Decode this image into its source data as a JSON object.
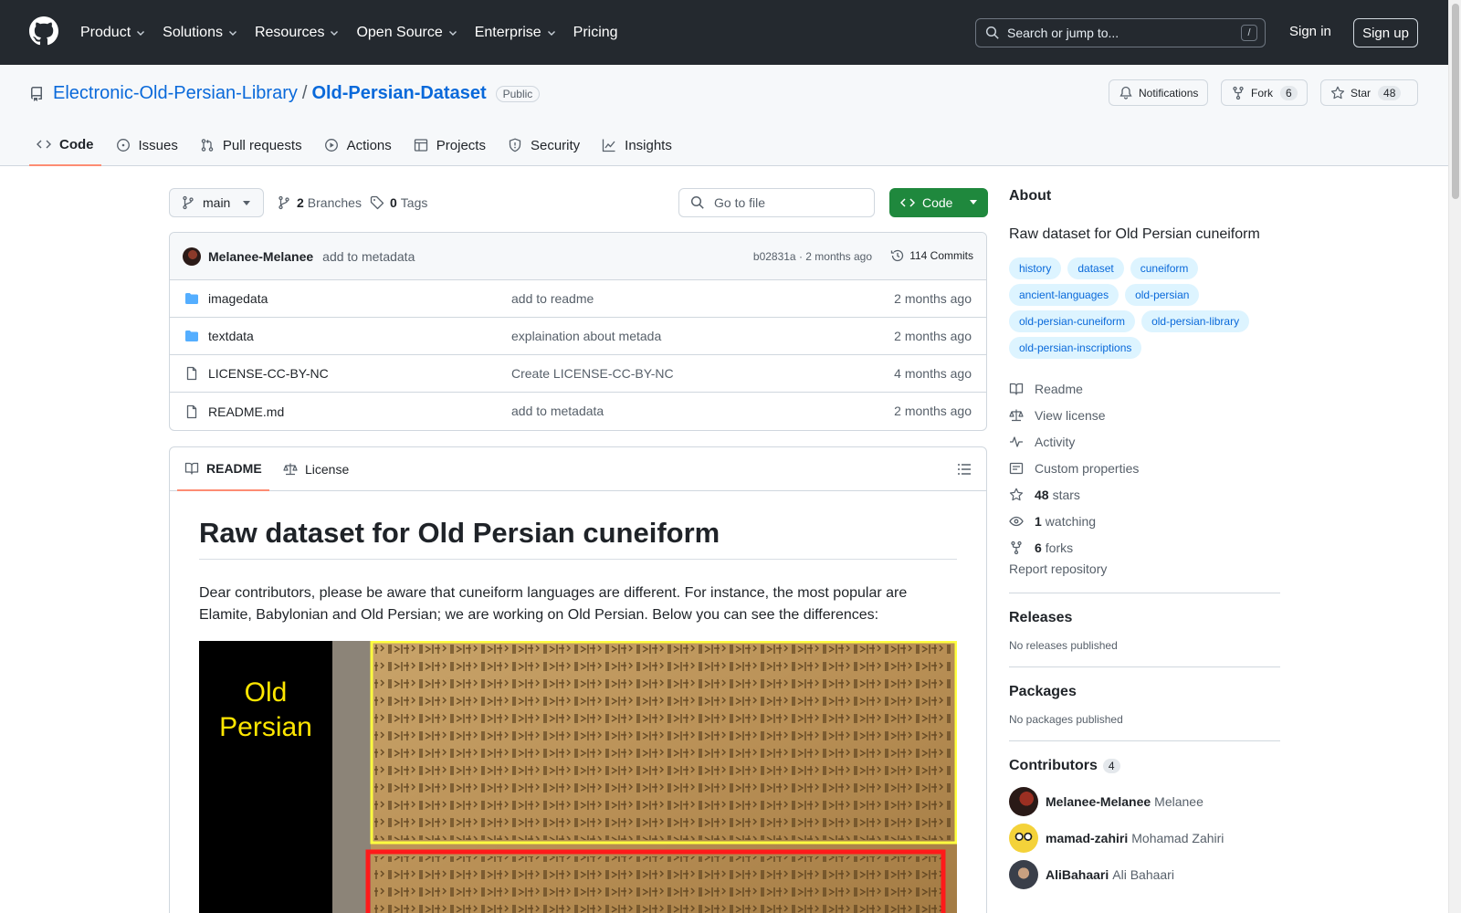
{
  "header": {
    "nav": [
      {
        "label": "Product",
        "has_menu": true
      },
      {
        "label": "Solutions",
        "has_menu": true
      },
      {
        "label": "Resources",
        "has_menu": true
      },
      {
        "label": "Open Source",
        "has_menu": true
      },
      {
        "label": "Enterprise",
        "has_menu": true
      },
      {
        "label": "Pricing",
        "has_menu": false
      }
    ],
    "search_placeholder": "Search or jump to...",
    "search_shortcut": "/",
    "sign_in": "Sign in",
    "sign_up": "Sign up"
  },
  "repo": {
    "owner": "Electronic-Old-Persian-Library",
    "separator": "/",
    "name": "Old-Persian-Dataset",
    "visibility": "Public",
    "notifications_label": "Notifications",
    "fork_label": "Fork",
    "fork_count": "6",
    "star_label": "Star",
    "star_count": "48",
    "tabs": [
      {
        "label": "Code",
        "icon": "code-icon"
      },
      {
        "label": "Issues",
        "icon": "issue-icon"
      },
      {
        "label": "Pull requests",
        "icon": "pull-request-icon"
      },
      {
        "label": "Actions",
        "icon": "play-icon"
      },
      {
        "label": "Projects",
        "icon": "table-icon"
      },
      {
        "label": "Security",
        "icon": "shield-icon"
      },
      {
        "label": "Insights",
        "icon": "graph-icon"
      }
    ],
    "active_tab": "Code"
  },
  "branchbar": {
    "branch": "main",
    "branches_count": "2",
    "branches_label": "Branches",
    "tags_count": "0",
    "tags_label": "Tags",
    "goto_file": "Go to file",
    "code_button": "Code"
  },
  "commit": {
    "author": "Melanee-Melanee",
    "message": "add to metadata",
    "meta": "b02831a · 2 months ago",
    "commits": "114 Commits"
  },
  "files": [
    {
      "name": "imagedata",
      "type": "folder",
      "message": "add to readme",
      "date": "2 months ago"
    },
    {
      "name": "textdata",
      "type": "folder",
      "message": "explaination about metada",
      "date": "2 months ago"
    },
    {
      "name": "LICENSE-CC-BY-NC",
      "type": "file",
      "message": "Create LICENSE-CC-BY-NC",
      "date": "4 months ago"
    },
    {
      "name": "README.md",
      "type": "file",
      "message": "add to metadata",
      "date": "2 months ago"
    }
  ],
  "readme": {
    "tab_readme": "README",
    "tab_license": "License",
    "title": "Raw dataset for Old Persian cuneiform",
    "paragraph": "Dear contributors, please be aware that cuneiform languages are different. For instance, the most popular are Elamite, Babylonian and Old Persian; we are working on Old Persian. Below you can see the differences:",
    "image_label_line1": "Old",
    "image_label_line2": "Persian"
  },
  "about": {
    "heading": "About",
    "description": "Raw dataset for Old Persian cuneiform",
    "topics": [
      "history",
      "dataset",
      "cuneiform",
      "ancient-languages",
      "old-persian",
      "old-persian-cuneiform",
      "old-persian-library",
      "old-persian-inscriptions"
    ],
    "links": [
      {
        "icon": "book-icon",
        "bold": "",
        "label": "Readme"
      },
      {
        "icon": "law-icon",
        "bold": "",
        "label": "View license"
      },
      {
        "icon": "pulse-icon",
        "bold": "",
        "label": "Activity"
      },
      {
        "icon": "note-icon",
        "bold": "",
        "label": "Custom properties"
      },
      {
        "icon": "star-icon",
        "bold": "48",
        "label": "stars"
      },
      {
        "icon": "eye-icon",
        "bold": "1",
        "label": "watching"
      },
      {
        "icon": "fork-icon",
        "bold": "6",
        "label": "forks"
      }
    ],
    "report": "Report repository"
  },
  "releases": {
    "heading": "Releases",
    "note": "No releases published"
  },
  "packages": {
    "heading": "Packages",
    "note": "No packages published"
  },
  "contributors": {
    "heading": "Contributors",
    "count": "4",
    "list": [
      {
        "login": "Melanee-Melanee",
        "name": "Melanee"
      },
      {
        "login": "mamad-zahiri",
        "name": "Mohamad Zahiri"
      },
      {
        "login": "AliBahaari",
        "name": "Ali Bahaari"
      }
    ]
  },
  "colors": {
    "link": "#0969da",
    "header_bg": "#24292f",
    "code_button": "#1f883d",
    "tab_underline": "#fd8c73"
  }
}
